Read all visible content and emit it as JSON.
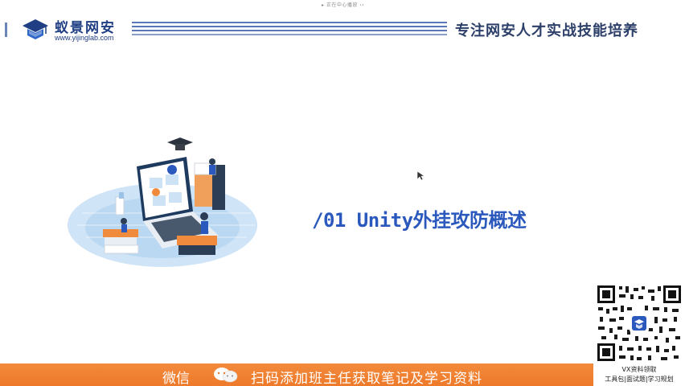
{
  "top_strip": {
    "text": "▸ 正在中心播放 ‹‹"
  },
  "logo": {
    "name": "蚁景网安",
    "url": "www.yijinglab.com"
  },
  "header": {
    "slogan": "专注网安人才实战技能培养"
  },
  "section": {
    "title": "/01 Unity外挂攻防概述"
  },
  "qr": {
    "caption_1": "VX资料领取",
    "caption_2": "工具包|面试题|学习规划"
  },
  "footer": {
    "wechat_label": "微信",
    "cta": "扫码添加班主任获取笔记及学习资料"
  },
  "colors": {
    "brand_blue": "#1f3e83",
    "title_blue": "#2a58bd",
    "footer_orange": "#ee7a2a"
  }
}
